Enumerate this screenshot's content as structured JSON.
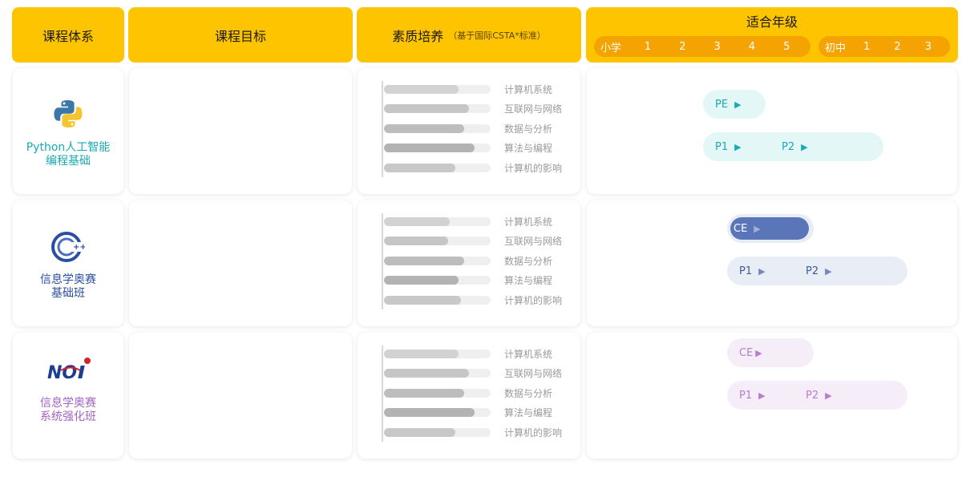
{
  "headers": {
    "course_system": "课程体系",
    "course_goal": "课程目标",
    "quality": "素质培养",
    "quality_note": "（基于国际CSTA*标准）",
    "age_title": "适合年级",
    "primary_label": "小学",
    "primary_grades": [
      "1",
      "2",
      "3",
      "4",
      "5"
    ],
    "junior_label": "初中",
    "junior_grades": [
      "1",
      "2",
      "3"
    ]
  },
  "skill_labels": [
    "计算机系统",
    "互联网与网络",
    "数据与分析",
    "算法与编程",
    "计算机的影响"
  ],
  "courses": [
    {
      "name_line1": "Python人工智能",
      "name_line2": "编程基础",
      "name_color": "#1aa9b5",
      "icon": "python-logo-icon",
      "skill_levels": [
        0.7,
        0.8,
        0.75,
        0.85,
        0.67
      ],
      "bar_color": "#cfcfcf",
      "tracks": [
        {
          "items": [
            "PE"
          ]
        },
        {
          "items": [
            "P1",
            "P2"
          ]
        }
      ],
      "track_bg": "#e3f7f7",
      "track_text": "#1aa9b5"
    },
    {
      "name_line1": "信息学奥赛",
      "name_line2": "基础班",
      "name_color": "#2a4fa2",
      "icon": "cpp-logo-icon",
      "skill_levels": [
        0.62,
        0.6,
        0.75,
        0.7,
        0.72
      ],
      "bar_color": "#cfcfcf",
      "tracks": [
        {
          "items": [
            "CE"
          ]
        },
        {
          "items": [
            "P1",
            "P2"
          ]
        }
      ],
      "track_bg": "#e9edf6",
      "track_text": "#3d5b9d",
      "active_bg": "#5a76b8"
    },
    {
      "name_line1": "信息学奥赛",
      "name_line2": "系统强化班",
      "name_color": "#a363c2",
      "icon": "noi-logo-icon",
      "skill_levels": [
        0.7,
        0.8,
        0.75,
        0.85,
        0.67
      ],
      "bar_color": "#cfcfcf",
      "tracks": [
        {
          "items": [
            "CE"
          ]
        },
        {
          "items": [
            "P1",
            "P2"
          ]
        }
      ],
      "track_bg": "#f5eef9",
      "track_text": "#b77dcf"
    }
  ]
}
